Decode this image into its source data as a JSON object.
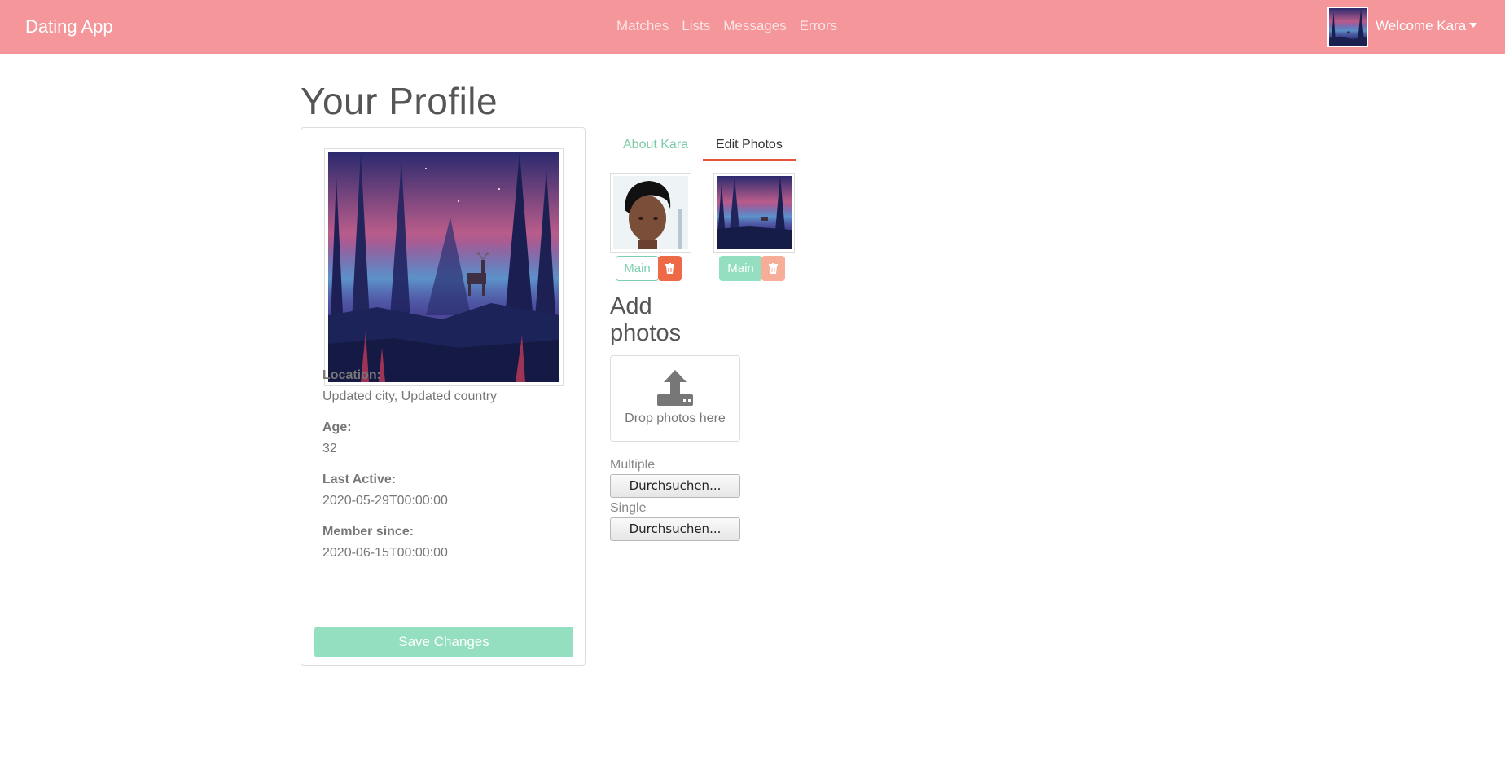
{
  "navbar": {
    "brand": "Dating App",
    "links": [
      "Matches",
      "Lists",
      "Messages",
      "Errors"
    ],
    "welcome": "Welcome Kara"
  },
  "page": {
    "title": "Your Profile"
  },
  "profile": {
    "location_label": "Location:",
    "location_value": "Updated city, Updated country",
    "age_label": "Age:",
    "age_value": "32",
    "last_active_label": "Last Active:",
    "last_active_value": "2020-05-29T00:00:00",
    "member_since_label": "Member since:",
    "member_since_value": "2020-06-15T00:00:00",
    "save_label": "Save Changes"
  },
  "tabs": {
    "about": "About Kara",
    "edit": "Edit Photos"
  },
  "photos": {
    "main_label": "Main"
  },
  "upload": {
    "title": "Add photos",
    "drop_text": "Drop photos here",
    "multiple_label": "Multiple",
    "single_label": "Single",
    "browse_label": "Durchsuchen..."
  },
  "colors": {
    "navbar": "#f4969a",
    "accent_green": "#93dfc0",
    "delete_red": "#ee6a47",
    "tab_underline": "#e4533a"
  },
  "icons": [
    "upload-icon",
    "trash-icon",
    "caret-down-icon"
  ]
}
